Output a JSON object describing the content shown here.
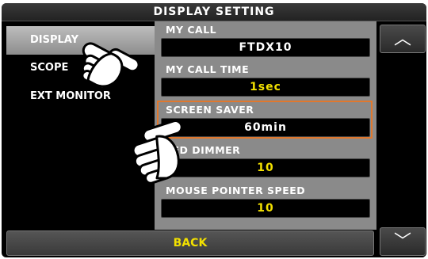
{
  "screen": {
    "title": "DISPLAY SETTING"
  },
  "sidebar": {
    "items": [
      {
        "label": "DISPLAY",
        "active": true
      },
      {
        "label": "SCOPE",
        "active": false
      },
      {
        "label": "EXT MONITOR",
        "active": false
      }
    ]
  },
  "settings": [
    {
      "label": "MY CALL",
      "value": "FTDX10",
      "value_color": "#ffffff"
    },
    {
      "label": "MY CALL TIME",
      "value": "1sec",
      "value_color": "#f2e000"
    },
    {
      "label": "SCREEN SAVER",
      "value": "60min",
      "value_color": "#ffffff",
      "selected": true
    },
    {
      "label": "LED DIMMER",
      "value": "10",
      "value_color": "#f2e000"
    },
    {
      "label": "MOUSE POINTER SPEED",
      "value": "10",
      "value_color": "#f2e000"
    }
  ],
  "nav": {
    "up_symbol": "︿",
    "down_symbol": "﹀",
    "back_label": "BACK"
  },
  "colors": {
    "highlight": "#e0782e",
    "value_yellow": "#f2e000",
    "panel": "#8a8a8a"
  },
  "overlays": [
    "pointing-hand-icon",
    "pointing-hand-icon"
  ]
}
